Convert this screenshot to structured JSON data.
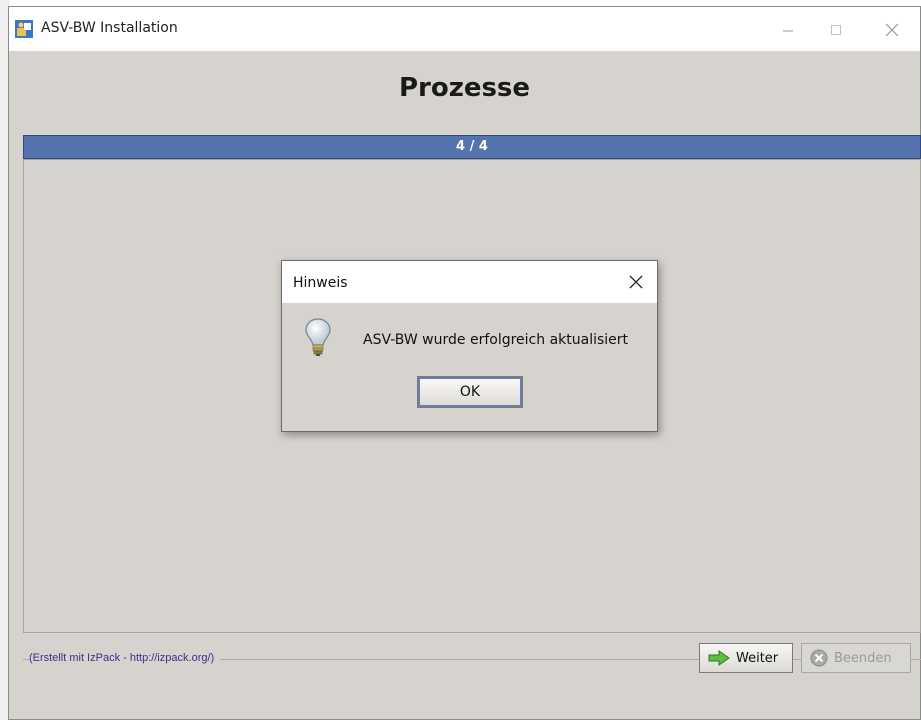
{
  "window": {
    "title": "ASV-BW Installation",
    "heading": "Prozesse"
  },
  "progress": {
    "label": "4 / 4",
    "fraction": 1.0
  },
  "footer": {
    "credit": "(Erstellt mit IzPack - http://izpack.org/)"
  },
  "buttons": {
    "next_label": "Weiter",
    "quit_label": "Beenden"
  },
  "dialog": {
    "title": "Hinweis",
    "message": "ASV-BW wurde erfolgreich aktualisiert",
    "ok_label": "OK"
  },
  "colors": {
    "panel": "#d6d3ce",
    "progress_bar": "#4d6ea9",
    "footer_text": "#3b2f8f"
  },
  "icons": {
    "app": "installer-icon",
    "dialog": "lightbulb-icon",
    "next": "arrow-right-icon",
    "quit": "cancel-circle-icon"
  }
}
